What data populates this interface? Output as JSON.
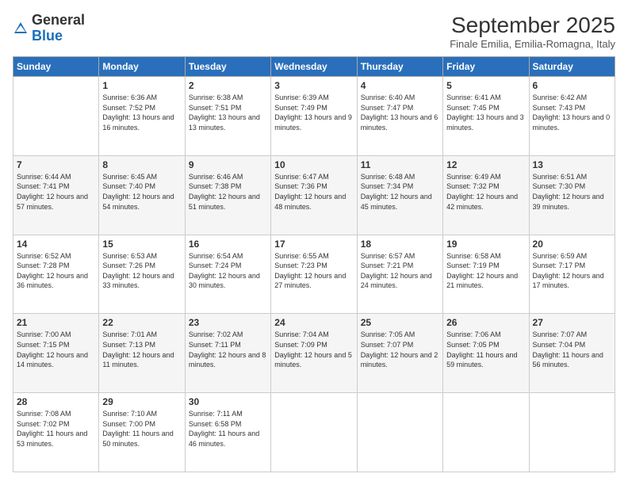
{
  "logo": {
    "general": "General",
    "blue": "Blue"
  },
  "title": "September 2025",
  "subtitle": "Finale Emilia, Emilia-Romagna, Italy",
  "days": [
    "Sunday",
    "Monday",
    "Tuesday",
    "Wednesday",
    "Thursday",
    "Friday",
    "Saturday"
  ],
  "weeks": [
    [
      {
        "num": "",
        "sunrise": "",
        "sunset": "",
        "daylight": ""
      },
      {
        "num": "1",
        "sunrise": "Sunrise: 6:36 AM",
        "sunset": "Sunset: 7:52 PM",
        "daylight": "Daylight: 13 hours and 16 minutes."
      },
      {
        "num": "2",
        "sunrise": "Sunrise: 6:38 AM",
        "sunset": "Sunset: 7:51 PM",
        "daylight": "Daylight: 13 hours and 13 minutes."
      },
      {
        "num": "3",
        "sunrise": "Sunrise: 6:39 AM",
        "sunset": "Sunset: 7:49 PM",
        "daylight": "Daylight: 13 hours and 9 minutes."
      },
      {
        "num": "4",
        "sunrise": "Sunrise: 6:40 AM",
        "sunset": "Sunset: 7:47 PM",
        "daylight": "Daylight: 13 hours and 6 minutes."
      },
      {
        "num": "5",
        "sunrise": "Sunrise: 6:41 AM",
        "sunset": "Sunset: 7:45 PM",
        "daylight": "Daylight: 13 hours and 3 minutes."
      },
      {
        "num": "6",
        "sunrise": "Sunrise: 6:42 AM",
        "sunset": "Sunset: 7:43 PM",
        "daylight": "Daylight: 13 hours and 0 minutes."
      }
    ],
    [
      {
        "num": "7",
        "sunrise": "Sunrise: 6:44 AM",
        "sunset": "Sunset: 7:41 PM",
        "daylight": "Daylight: 12 hours and 57 minutes."
      },
      {
        "num": "8",
        "sunrise": "Sunrise: 6:45 AM",
        "sunset": "Sunset: 7:40 PM",
        "daylight": "Daylight: 12 hours and 54 minutes."
      },
      {
        "num": "9",
        "sunrise": "Sunrise: 6:46 AM",
        "sunset": "Sunset: 7:38 PM",
        "daylight": "Daylight: 12 hours and 51 minutes."
      },
      {
        "num": "10",
        "sunrise": "Sunrise: 6:47 AM",
        "sunset": "Sunset: 7:36 PM",
        "daylight": "Daylight: 12 hours and 48 minutes."
      },
      {
        "num": "11",
        "sunrise": "Sunrise: 6:48 AM",
        "sunset": "Sunset: 7:34 PM",
        "daylight": "Daylight: 12 hours and 45 minutes."
      },
      {
        "num": "12",
        "sunrise": "Sunrise: 6:49 AM",
        "sunset": "Sunset: 7:32 PM",
        "daylight": "Daylight: 12 hours and 42 minutes."
      },
      {
        "num": "13",
        "sunrise": "Sunrise: 6:51 AM",
        "sunset": "Sunset: 7:30 PM",
        "daylight": "Daylight: 12 hours and 39 minutes."
      }
    ],
    [
      {
        "num": "14",
        "sunrise": "Sunrise: 6:52 AM",
        "sunset": "Sunset: 7:28 PM",
        "daylight": "Daylight: 12 hours and 36 minutes."
      },
      {
        "num": "15",
        "sunrise": "Sunrise: 6:53 AM",
        "sunset": "Sunset: 7:26 PM",
        "daylight": "Daylight: 12 hours and 33 minutes."
      },
      {
        "num": "16",
        "sunrise": "Sunrise: 6:54 AM",
        "sunset": "Sunset: 7:24 PM",
        "daylight": "Daylight: 12 hours and 30 minutes."
      },
      {
        "num": "17",
        "sunrise": "Sunrise: 6:55 AM",
        "sunset": "Sunset: 7:23 PM",
        "daylight": "Daylight: 12 hours and 27 minutes."
      },
      {
        "num": "18",
        "sunrise": "Sunrise: 6:57 AM",
        "sunset": "Sunset: 7:21 PM",
        "daylight": "Daylight: 12 hours and 24 minutes."
      },
      {
        "num": "19",
        "sunrise": "Sunrise: 6:58 AM",
        "sunset": "Sunset: 7:19 PM",
        "daylight": "Daylight: 12 hours and 21 minutes."
      },
      {
        "num": "20",
        "sunrise": "Sunrise: 6:59 AM",
        "sunset": "Sunset: 7:17 PM",
        "daylight": "Daylight: 12 hours and 17 minutes."
      }
    ],
    [
      {
        "num": "21",
        "sunrise": "Sunrise: 7:00 AM",
        "sunset": "Sunset: 7:15 PM",
        "daylight": "Daylight: 12 hours and 14 minutes."
      },
      {
        "num": "22",
        "sunrise": "Sunrise: 7:01 AM",
        "sunset": "Sunset: 7:13 PM",
        "daylight": "Daylight: 12 hours and 11 minutes."
      },
      {
        "num": "23",
        "sunrise": "Sunrise: 7:02 AM",
        "sunset": "Sunset: 7:11 PM",
        "daylight": "Daylight: 12 hours and 8 minutes."
      },
      {
        "num": "24",
        "sunrise": "Sunrise: 7:04 AM",
        "sunset": "Sunset: 7:09 PM",
        "daylight": "Daylight: 12 hours and 5 minutes."
      },
      {
        "num": "25",
        "sunrise": "Sunrise: 7:05 AM",
        "sunset": "Sunset: 7:07 PM",
        "daylight": "Daylight: 12 hours and 2 minutes."
      },
      {
        "num": "26",
        "sunrise": "Sunrise: 7:06 AM",
        "sunset": "Sunset: 7:05 PM",
        "daylight": "Daylight: 11 hours and 59 minutes."
      },
      {
        "num": "27",
        "sunrise": "Sunrise: 7:07 AM",
        "sunset": "Sunset: 7:04 PM",
        "daylight": "Daylight: 11 hours and 56 minutes."
      }
    ],
    [
      {
        "num": "28",
        "sunrise": "Sunrise: 7:08 AM",
        "sunset": "Sunset: 7:02 PM",
        "daylight": "Daylight: 11 hours and 53 minutes."
      },
      {
        "num": "29",
        "sunrise": "Sunrise: 7:10 AM",
        "sunset": "Sunset: 7:00 PM",
        "daylight": "Daylight: 11 hours and 50 minutes."
      },
      {
        "num": "30",
        "sunrise": "Sunrise: 7:11 AM",
        "sunset": "Sunset: 6:58 PM",
        "daylight": "Daylight: 11 hours and 46 minutes."
      },
      {
        "num": "",
        "sunrise": "",
        "sunset": "",
        "daylight": ""
      },
      {
        "num": "",
        "sunrise": "",
        "sunset": "",
        "daylight": ""
      },
      {
        "num": "",
        "sunrise": "",
        "sunset": "",
        "daylight": ""
      },
      {
        "num": "",
        "sunrise": "",
        "sunset": "",
        "daylight": ""
      }
    ]
  ]
}
